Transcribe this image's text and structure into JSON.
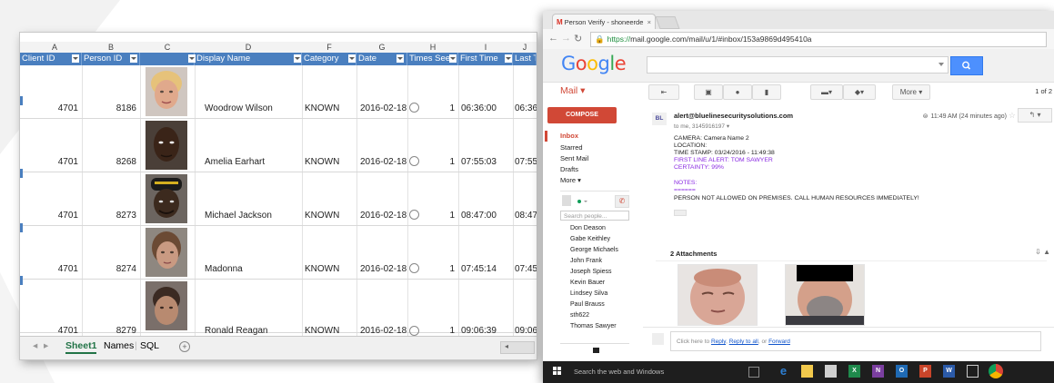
{
  "excel": {
    "col_letters": [
      "A",
      "B",
      "C",
      "D",
      "F",
      "G",
      "H",
      "I",
      "J"
    ],
    "headers": [
      "Client ID",
      "Person ID",
      "",
      "Display Name",
      "Category",
      "Date",
      "Times See",
      "First Time",
      "Last Ti"
    ],
    "rows": [
      {
        "client_id": "4701",
        "person_id": "8186",
        "name": "Woodrow Wilson",
        "category": "KNOWN",
        "date": "2016-02-18",
        "times_seen": "1",
        "first_time": "06:36:00",
        "last_time": "06:36:"
      },
      {
        "client_id": "4701",
        "person_id": "8268",
        "name": "Amelia Earhart",
        "category": "KNOWN",
        "date": "2016-02-18",
        "times_seen": "1",
        "first_time": "07:55:03",
        "last_time": "07:55:"
      },
      {
        "client_id": "4701",
        "person_id": "8273",
        "name": "Michael Jackson",
        "category": "KNOWN",
        "date": "2016-02-18",
        "times_seen": "1",
        "first_time": "08:47:00",
        "last_time": "08:47:"
      },
      {
        "client_id": "4701",
        "person_id": "8274",
        "name": "Madonna",
        "category": "KNOWN",
        "date": "2016-02-18",
        "times_seen": "1",
        "first_time": "07:45:14",
        "last_time": "07:45:"
      },
      {
        "client_id": "4701",
        "person_id": "8279",
        "name": "Ronald Reagan",
        "category": "KNOWN",
        "date": "2016-02-18",
        "times_seen": "1",
        "first_time": "09:06:39",
        "last_time": "09:06:"
      }
    ],
    "sheet_tabs": [
      "Sheet1",
      "Names",
      "SQL"
    ],
    "add_sheet": "+"
  },
  "browser": {
    "tab_title": "Person Verify - shoneerde",
    "tab_close": "×",
    "url_https": "https://",
    "url_rest": "mail.google.com/mail/u/1/#inbox/153a9869d495410a",
    "logo_letters": [
      "G",
      "o",
      "o",
      "g",
      "l",
      "e"
    ],
    "logo_colors": [
      "#4285f4",
      "#ea4335",
      "#fbbc05",
      "#4285f4",
      "#34a853",
      "#ea4335"
    ],
    "mail_label": "Mail ▾",
    "more_label": "More ▾",
    "page_indicator": "1 of 2",
    "compose": "COMPOSE",
    "folders": [
      "Inbox",
      "Starred",
      "Sent Mail",
      "Drafts",
      "More ▾"
    ],
    "search_people": "Search people...",
    "contacts": [
      "Don Deason",
      "Gabe Keithley",
      "George Michaels",
      "John Frank",
      "Joseph Spiess",
      "Kevin Bauer",
      "Lindsey Silva",
      "Paul Brauss",
      "sth622",
      "Thomas Sawyer"
    ],
    "email": {
      "avatar_text": "BL",
      "from": "alert@bluelinesecuritysolutions.com",
      "to": "to me, 3145916197 ▾",
      "time": "11:49 AM (24 minutes ago)",
      "body_lines": [
        "CAMERA: Camera Name 2",
        "LOCATION:",
        "TIME STAMP: 03/24/2016 - 11:49:38"
      ],
      "alert_lines": [
        "FIRST LINE ALERT: TOM SAWYER",
        "CERTAINTY: 99%"
      ],
      "notes_label": "NOTES:",
      "notes_sep": "======",
      "notes_text": "PERSON NOT ALLOWED ON PREMISES. CALL HUMAN RESOURCES IMMEDIATELY!",
      "attachments_title": "2 Attachments"
    },
    "reply_prompt": {
      "pre": "Click here to ",
      "reply": "Reply",
      "sep1": ", ",
      "reply_all": "Reply to all",
      "sep2": ", or ",
      "forward": "Forward"
    }
  },
  "taskbar": {
    "search_text": "Search the web and Windows",
    "icon_labels": [
      "e",
      "X",
      "N",
      "O",
      "P",
      "W"
    ]
  },
  "colors": {
    "excel_header": "#4a7fbf",
    "excel_green": "#217346",
    "gmail_red": "#d14836",
    "gmail_blue": "#4d90fe",
    "alert_purple": "#8a2be2",
    "taskbar": "#1e1e1e"
  }
}
